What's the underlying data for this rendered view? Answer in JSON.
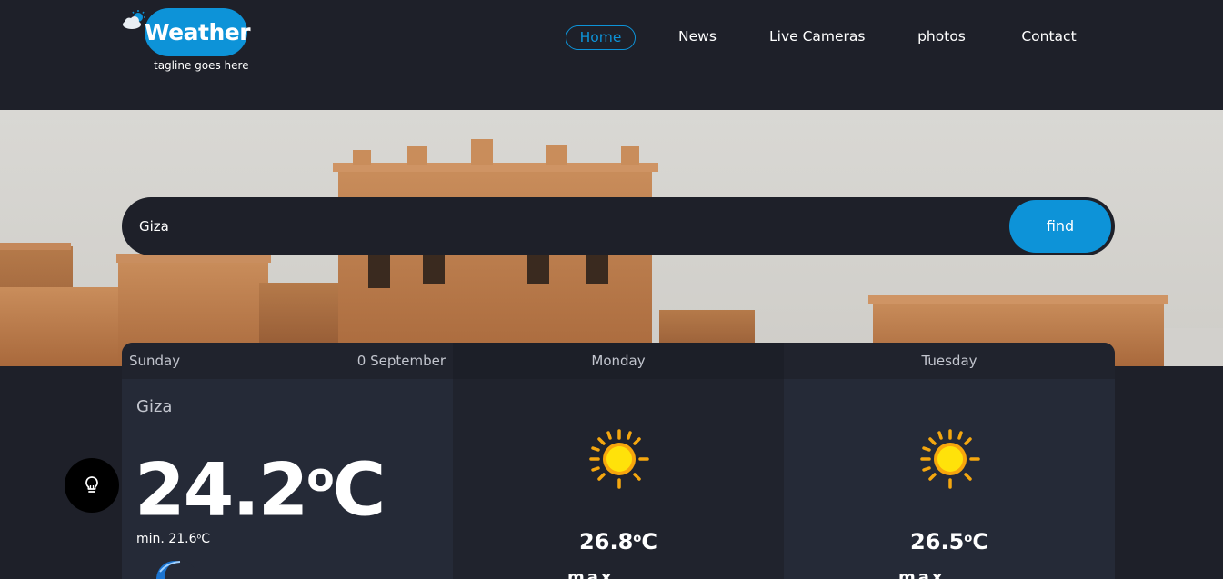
{
  "header": {
    "logo_text": "Weather",
    "tagline": "tagline goes here",
    "nav": [
      {
        "label": "Home",
        "active": true
      },
      {
        "label": "News",
        "active": false
      },
      {
        "label": "Live Cameras",
        "active": false
      },
      {
        "label": "photos",
        "active": false
      },
      {
        "label": "Contact",
        "active": false
      }
    ]
  },
  "search": {
    "value": "Giza",
    "button_label": "find"
  },
  "forecast": {
    "today": {
      "day": "Sunday",
      "date": "0 September",
      "city": "Giza",
      "temp": "24.2",
      "temp_unit": "C",
      "min_label": "min. 21.6",
      "min_unit": "C",
      "icon": "moon-icon"
    },
    "days": [
      {
        "day": "Monday",
        "temp": "26.8",
        "unit": "C",
        "icon": "sun-icon",
        "max_label": "max"
      },
      {
        "day": "Tuesday",
        "temp": "26.5",
        "unit": "C",
        "icon": "sun-icon",
        "max_label": "max"
      }
    ]
  },
  "colors": {
    "accent": "#0d93d8",
    "background": "#1e2029",
    "card": "#252a37",
    "card_alt": "#20232d",
    "muted_text": "#c3c6cf"
  },
  "tip_button": {
    "icon": "lightbulb-icon"
  }
}
